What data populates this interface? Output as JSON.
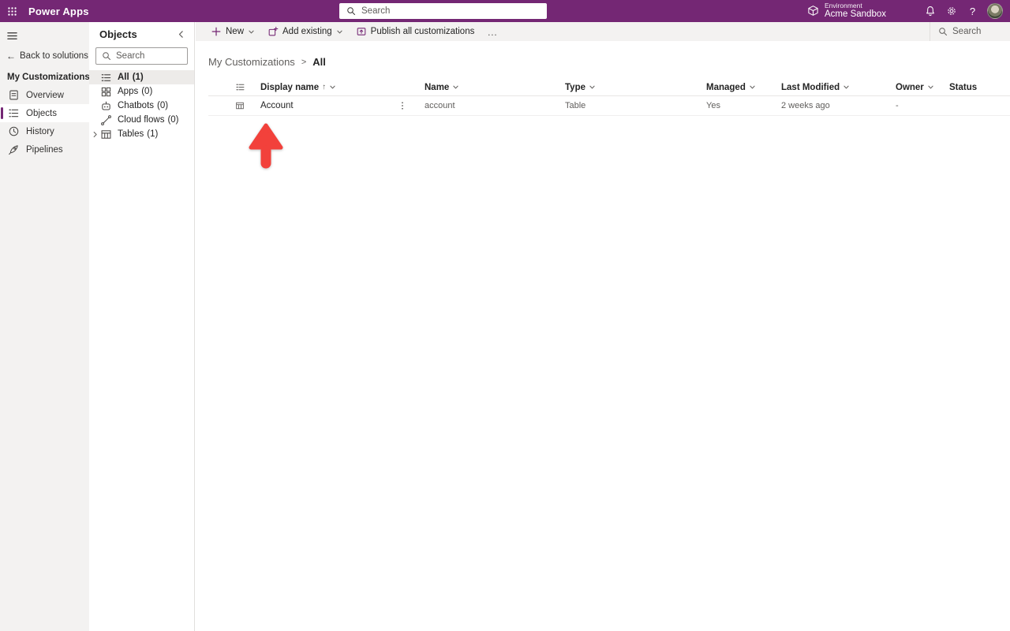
{
  "colors": {
    "header_bg": "#742774",
    "accent": "#742774",
    "toolbar_bg": "#f3f2f1",
    "nav_bg": "#f3f2f1",
    "tree_selected_bg": "#edebe9",
    "arrow_red": "#f2413b"
  },
  "glyphs": {
    "back_arrow": "←",
    "sort_ascending": "↑",
    "ellipsis": "…",
    "help": "?",
    "breadcrumb_separator": ">"
  },
  "header": {
    "app_title": "Power Apps",
    "search_placeholder": "Search",
    "environment_label": "Environment",
    "environment_name": "Acme Sandbox"
  },
  "left_nav": {
    "back_label": "Back to solutions",
    "solution_name": "My Customizations",
    "items": [
      {
        "label": "Overview"
      },
      {
        "label": "Objects"
      },
      {
        "label": "History"
      },
      {
        "label": "Pipelines"
      }
    ]
  },
  "objects_panel": {
    "title": "Objects",
    "search_placeholder": "Search",
    "items": [
      {
        "label": "All",
        "count": "(1)"
      },
      {
        "label": "Apps",
        "count": "(0)"
      },
      {
        "label": "Chatbots",
        "count": "(0)"
      },
      {
        "label": "Cloud flows",
        "count": "(0)"
      },
      {
        "label": "Tables",
        "count": "(1)"
      }
    ]
  },
  "toolbar": {
    "new_label": "New",
    "add_existing_label": "Add existing",
    "publish_label": "Publish all customizations",
    "search_placeholder": "Search"
  },
  "breadcrumb": {
    "parent": "My Customizations",
    "current": "All"
  },
  "table": {
    "headers": {
      "display_name": "Display name",
      "name": "Name",
      "type": "Type",
      "managed": "Managed",
      "last_modified": "Last Modified",
      "owner": "Owner",
      "status": "Status"
    },
    "rows": [
      {
        "display_name": "Account",
        "name": "account",
        "type": "Table",
        "managed": "Yes",
        "last_modified": "2 weeks ago",
        "owner": "-",
        "status": ""
      }
    ]
  }
}
